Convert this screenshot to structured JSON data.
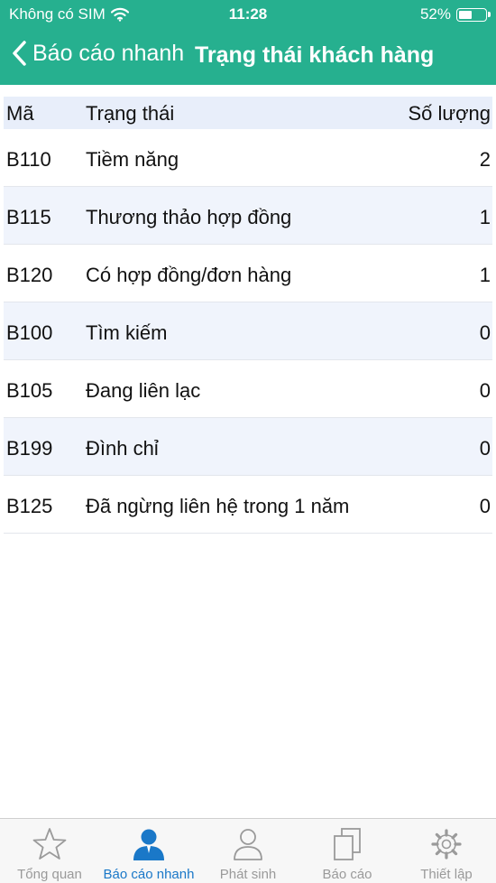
{
  "status": {
    "carrier": "Không có SIM",
    "time": "11:28",
    "battery": "52%",
    "battery_level": 0.52
  },
  "nav": {
    "back_label": "Báo cáo nhanh",
    "title": "Trạng thái khách hàng"
  },
  "table": {
    "headers": {
      "code": "Mã",
      "status": "Trạng thái",
      "count": "Số lượng"
    },
    "rows": [
      {
        "code": "B110",
        "status": "Tiềm năng",
        "count": "2"
      },
      {
        "code": "B115",
        "status": "Thương thảo hợp đồng",
        "count": "1"
      },
      {
        "code": "B120",
        "status": "Có hợp đồng/đơn hàng",
        "count": "1"
      },
      {
        "code": "B100",
        "status": "Tìm kiếm",
        "count": "0"
      },
      {
        "code": "B105",
        "status": "Đang liên lạc",
        "count": "0"
      },
      {
        "code": "B199",
        "status": "Đình chỉ",
        "count": "0"
      },
      {
        "code": "B125",
        "status": "Đã ngừng liên hệ trong 1 năm",
        "count": "0"
      }
    ]
  },
  "tabs": [
    {
      "label": "Tổng quan",
      "icon": "star-icon",
      "active": false
    },
    {
      "label": "Báo cáo nhanh",
      "icon": "person-icon",
      "active": true
    },
    {
      "label": "Phát sinh",
      "icon": "user-outline-icon",
      "active": false
    },
    {
      "label": "Báo cáo",
      "icon": "copy-icon",
      "active": false
    },
    {
      "label": "Thiết lập",
      "icon": "gear-icon",
      "active": false
    }
  ],
  "colors": {
    "header": "#26b08f",
    "active_tab": "#1a78c8",
    "inactive_tab": "#9a9a9a",
    "row_alt": "#f0f4fc"
  }
}
